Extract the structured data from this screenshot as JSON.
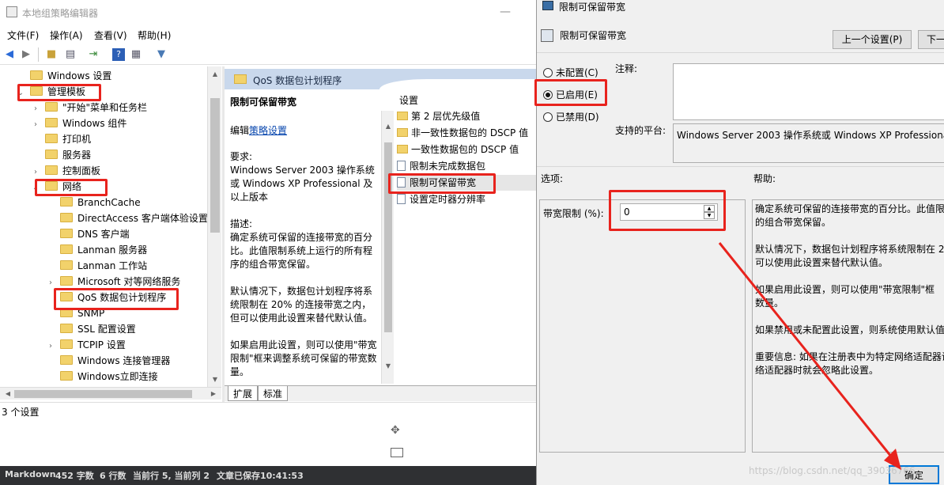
{
  "mmc": {
    "title": "本地组策略编辑器",
    "menu": [
      "文件(F)",
      "操作(A)",
      "查看(V)",
      "帮助(H)"
    ],
    "tree": [
      {
        "label": "Windows 设置",
        "indent": 0,
        "exp": "",
        "y": 0
      },
      {
        "label": "管理模板",
        "indent": 0,
        "exp": "v",
        "y": 1
      },
      {
        "label": "\"开始\"菜单和任务栏",
        "indent": 1,
        "exp": ">",
        "y": 2
      },
      {
        "label": "Windows 组件",
        "indent": 1,
        "exp": ">",
        "y": 3
      },
      {
        "label": "打印机",
        "indent": 1,
        "exp": "",
        "y": 4
      },
      {
        "label": "服务器",
        "indent": 1,
        "exp": "",
        "y": 5
      },
      {
        "label": "控制面板",
        "indent": 1,
        "exp": ">",
        "y": 6
      },
      {
        "label": "网络",
        "indent": 1,
        "exp": "v",
        "y": 7
      },
      {
        "label": "BranchCache",
        "indent": 2,
        "exp": "",
        "y": 8
      },
      {
        "label": "DirectAccess 客户端体验设置",
        "indent": 2,
        "exp": "",
        "y": 9
      },
      {
        "label": "DNS 客户端",
        "indent": 2,
        "exp": "",
        "y": 10
      },
      {
        "label": "Lanman 服务器",
        "indent": 2,
        "exp": "",
        "y": 11
      },
      {
        "label": "Lanman 工作站",
        "indent": 2,
        "exp": "",
        "y": 12
      },
      {
        "label": "Microsoft 对等网络服务",
        "indent": 2,
        "exp": ">",
        "y": 13
      },
      {
        "label": "QoS 数据包计划程序",
        "indent": 2,
        "exp": "",
        "y": 14
      },
      {
        "label": "SNMP",
        "indent": 2,
        "exp": "",
        "y": 15
      },
      {
        "label": "SSL 配置设置",
        "indent": 2,
        "exp": "",
        "y": 16
      },
      {
        "label": "TCPIP 设置",
        "indent": 2,
        "exp": ">",
        "y": 17
      },
      {
        "label": "Windows 连接管理器",
        "indent": 2,
        "exp": "",
        "y": 18
      },
      {
        "label": "Windows立即连接",
        "indent": 2,
        "exp": "",
        "y": 19
      }
    ],
    "pane_header": "QoS 数据包计划程序",
    "desc_title": "限制可保留带宽",
    "desc_edit_prefix": "编辑",
    "desc_edit_link": "策略设置",
    "desc_req_label": "要求:",
    "desc_req_text": "Windows Server 2003 操作系统或 Windows XP Professional 及以上版本",
    "desc_label": "描述:",
    "desc_text1": "确定系统可保留的连接带宽的百分比。此值限制系统上运行的所有程序的组合带宽保留。",
    "desc_text2": "默认情况下，数据包计划程序将系统限制在 20% 的连接带宽之内，但可以使用此设置来替代默认值。",
    "desc_text3": "如果启用此设置，则可以使用\"带宽限制\"框来调整系统可保留的带宽数量。",
    "settings_header": "设置",
    "settings": [
      {
        "label": "第 2 层优先级值",
        "kind": "folder"
      },
      {
        "label": "非一致性数据包的 DSCP 值",
        "kind": "folder"
      },
      {
        "label": "一致性数据包的 DSCP 值",
        "kind": "folder"
      },
      {
        "label": "限制未完成数据包",
        "kind": "doc"
      },
      {
        "label": "限制可保留带宽",
        "kind": "doc"
      },
      {
        "label": "设置定时器分辨率",
        "kind": "doc"
      }
    ],
    "tabs": [
      "扩展",
      "标准"
    ],
    "status": "3 个设置"
  },
  "markdown_bar": {
    "name": "Markdown",
    "words": "452 字数",
    "lines": "6 行数",
    "cursor": "当前行 5, 当前列 2",
    "saved": "文章已保存10:41:53"
  },
  "dialog": {
    "title": "限制可保留带宽",
    "policy_name": "限制可保留带宽",
    "prev_button": "上一个设置(P)",
    "next_button": "下一",
    "radio_unconfigured": "未配置(C)",
    "radio_enabled": "已启用(E)",
    "radio_disabled": "已禁用(D)",
    "selected": "enabled",
    "comment_label": "注释:",
    "platform_label": "支持的平台:",
    "platform_value": "Windows Server 2003 操作系统或 Windows XP Professional",
    "options_label": "选项:",
    "help_label": "帮助:",
    "bandwidth_label": "带宽限制 (%):",
    "bandwidth_value": "0",
    "help_lines": [
      "确定系统可保留的连接带宽的百分比。此值限",
      "的组合带宽保留。",
      "",
      "默认情况下，数据包计划程序将系统限制在 20",
      "可以使用此设置来替代默认值。",
      "",
      "如果启用此设置，则可以使用\"带宽限制\"框",
      "数量。",
      "",
      "如果禁用或未配置此设置，则系统使用默认值",
      "",
      "重要信息: 如果在注册表中为特定网络适配器设",
      "络适配器时就会忽略此设置。"
    ],
    "ok_button": "确定",
    "watermark": "https://blog.csdn.net/qq_39036766"
  },
  "colors": {
    "annotation_red": "#e8231d",
    "pane_header_bg": "#c9d8ec",
    "dialog_bg": "#f0f0f0"
  }
}
